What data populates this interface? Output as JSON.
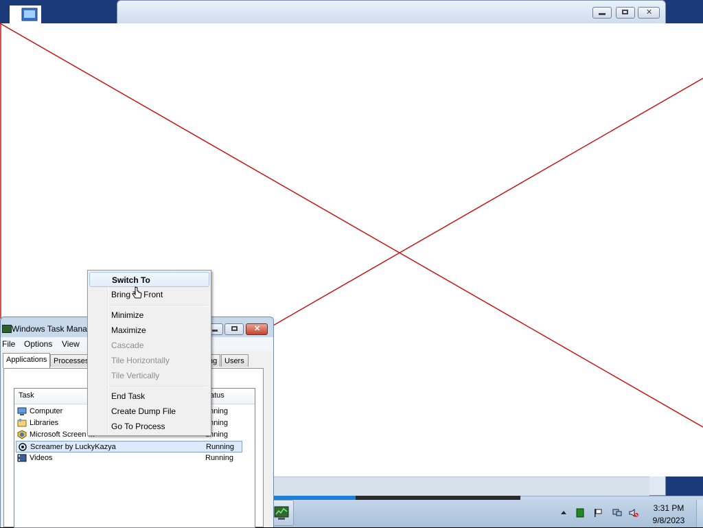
{
  "background_window": {
    "controls": {
      "minimize": "minimize",
      "restore": "restore",
      "close": "close"
    }
  },
  "task_manager": {
    "title": "Windows Task Mana",
    "menu": [
      "File",
      "Options",
      "View"
    ],
    "tabs": [
      "Applications",
      "Processes",
      "ng",
      "Users"
    ],
    "active_tab": "Applications",
    "columns": {
      "task": "Task",
      "status": "atus"
    },
    "rows": [
      {
        "name": "Computer",
        "status": "unning",
        "icon": "computer-icon"
      },
      {
        "name": "Libraries",
        "status": "unning",
        "icon": "libraries-icon"
      },
      {
        "name": "Microsoft Screen M",
        "status": "unning",
        "icon": "screen-magnifier-icon"
      },
      {
        "name": "Screamer by LuckyKazya",
        "status": "Running",
        "icon": "screamer-icon",
        "selected": true
      },
      {
        "name": "Videos",
        "status": "Running",
        "icon": "videos-icon"
      }
    ]
  },
  "context_menu": {
    "items": [
      {
        "label": "Switch To",
        "bold": true,
        "highlighted": true
      },
      {
        "label": "Bring To Front"
      },
      {
        "separator": true
      },
      {
        "label": "Minimize"
      },
      {
        "label": "Maximize"
      },
      {
        "label": "Cascade",
        "disabled": true
      },
      {
        "label": "Tile Horizontally",
        "disabled": true
      },
      {
        "label": "Tile Vertically",
        "disabled": true
      },
      {
        "separator": true
      },
      {
        "label": "End Task"
      },
      {
        "label": "Create Dump File"
      },
      {
        "label": "Go To Process"
      }
    ]
  },
  "taskbar": {
    "clock_time": "3:31 PM",
    "clock_date": "9/8/2023",
    "tray_icons": [
      "show-hidden-icons",
      "network-activity-icon",
      "action-center-flag-icon",
      "network-icon",
      "volume-muted-icon"
    ]
  },
  "colors": {
    "overlay_line": "#c81414",
    "taskbar_progress": "#1e7fd8",
    "selection": "#dceafc"
  }
}
